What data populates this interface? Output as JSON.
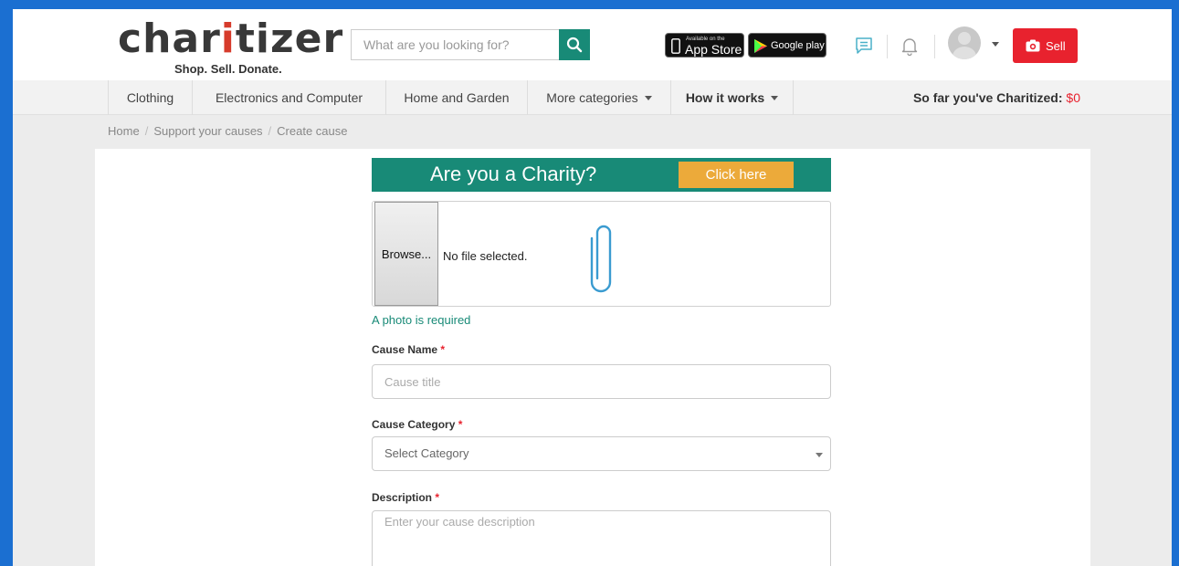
{
  "header": {
    "logo_part1": "char",
    "logo_part2": "i",
    "logo_part3": "tizer",
    "tagline": "Shop. Sell. Donate.",
    "search_placeholder": "What are you looking for?",
    "appstore_small": "Available on the",
    "appstore_big": "App Store",
    "gplay_big": "Google play",
    "sell_label": "Sell"
  },
  "nav": {
    "items": [
      {
        "label": "Clothing"
      },
      {
        "label": "Electronics and Computer"
      },
      {
        "label": "Home and Garden"
      },
      {
        "label": "More categories"
      },
      {
        "label": "How it works"
      }
    ],
    "charitized_label": "So far you've Charitized:",
    "charitized_amount": "$0"
  },
  "breadcrumb": [
    "Home",
    "Support your causes",
    "Create cause"
  ],
  "banner": {
    "title": "Are you a Charity?",
    "button": "Click here"
  },
  "upload": {
    "browse_label": "Browse...",
    "no_file": "No file selected.",
    "required_msg": "A photo is required"
  },
  "form": {
    "cause_name_label": "Cause Name",
    "cause_name_placeholder": "Cause title",
    "category_label": "Cause Category",
    "category_value": "Select Category",
    "description_label": "Description",
    "description_placeholder": "Enter your cause description",
    "required_star": "*"
  },
  "colors": {
    "brand_green": "#188a77",
    "accent_red": "#e8222e",
    "button_orange": "#ecaa3a"
  }
}
